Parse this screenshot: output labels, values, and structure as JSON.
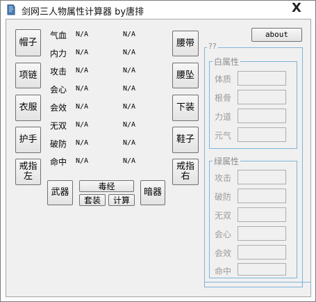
{
  "window": {
    "title": "剑网三人物属性计算器 by唐排",
    "close_label": "X"
  },
  "left_buttons": [
    "帽子",
    "项链",
    "衣服",
    "护手",
    "戒指左"
  ],
  "right_buttons": [
    "腰带",
    "腰坠",
    "下装",
    "鞋子",
    "戒指右"
  ],
  "stats": [
    {
      "label": "气血",
      "value1": "N/A",
      "value2": "N/A"
    },
    {
      "label": "内力",
      "value1": "N/A",
      "value2": "N/A"
    },
    {
      "label": "攻击",
      "value1": "N/A",
      "value2": "N/A"
    },
    {
      "label": "会心",
      "value1": "N/A",
      "value2": "N/A"
    },
    {
      "label": "会效",
      "value1": "N/A",
      "value2": "N/A"
    },
    {
      "label": "无双",
      "value1": "N/A",
      "value2": "N/A"
    },
    {
      "label": "破防",
      "value1": "N/A",
      "value2": "N/A"
    },
    {
      "label": "命中",
      "value1": "N/A",
      "value2": "N/A"
    }
  ],
  "bottom_buttons": {
    "weapon": "武器",
    "school": "毒经",
    "set": "套装",
    "calculate": "计算",
    "hidden_weapon": "暗器"
  },
  "about_label": "about",
  "outer_group_title": "??",
  "white_attrs": {
    "title": "白属性",
    "items": [
      "体质",
      "根骨",
      "力道",
      "元气"
    ]
  },
  "green_attrs": {
    "title": "绿属性",
    "items": [
      "攻击",
      "破防",
      "无双",
      "会心",
      "会效",
      "命中"
    ]
  },
  "colors": {
    "group_border": "#7fb4d9",
    "disabled_text": "#9a9a9a"
  }
}
